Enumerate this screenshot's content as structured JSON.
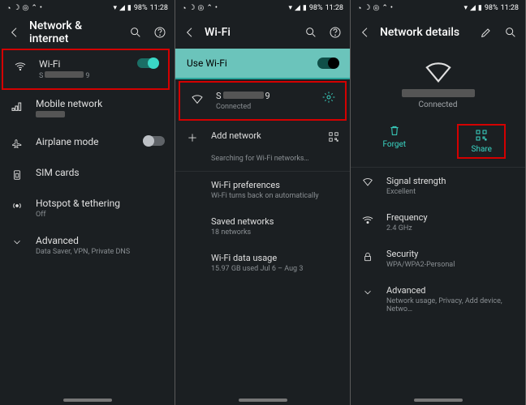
{
  "statusbar": {
    "battery": "98%",
    "time": "11:28"
  },
  "panel1": {
    "title": "Network & internet",
    "items": [
      {
        "label": "Wi-Fi",
        "sub_a": "S",
        "sub_b": "9"
      },
      {
        "label": "Mobile network",
        "sub": " "
      },
      {
        "label": "Airplane mode"
      },
      {
        "label": "SIM cards"
      },
      {
        "label": "Hotspot & tethering",
        "sub": "Off"
      },
      {
        "label": "Advanced",
        "sub": "Data Saver, VPN, Private DNS"
      }
    ]
  },
  "panel2": {
    "title": "Wi-Fi",
    "use_wifi": "Use Wi-Fi",
    "network": {
      "name_a": "S",
      "name_b": "9",
      "status": "Connected"
    },
    "add": "Add network",
    "searching": "Searching for Wi-Fi networks…",
    "items": [
      {
        "label": "Wi-Fi preferences",
        "sub": "Wi-Fi turns back on automatically"
      },
      {
        "label": "Saved networks",
        "sub": "18 networks"
      },
      {
        "label": "Wi-Fi data usage",
        "sub": "15.97 GB used Jul 6 – Aug 3"
      }
    ]
  },
  "panel3": {
    "title": "Network details",
    "status": "Connected",
    "forget": "Forget",
    "share": "Share",
    "items": [
      {
        "label": "Signal strength",
        "sub": "Excellent"
      },
      {
        "label": "Frequency",
        "sub": "2.4 GHz"
      },
      {
        "label": "Security",
        "sub": "WPA/WPA2-Personal"
      },
      {
        "label": "Advanced",
        "sub": "Network usage, Privacy, Add device, Netwo…"
      }
    ]
  }
}
